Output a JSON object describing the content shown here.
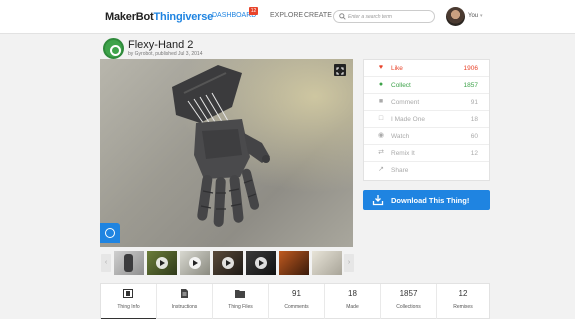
{
  "header": {
    "logo_makerbot": "MakerBot",
    "logo_thingiverse": "Thingiverse",
    "nav": [
      {
        "label": "DASHBOARD",
        "badge": "12"
      },
      {
        "label": "EXPLORE"
      },
      {
        "label": "CREATE"
      }
    ],
    "search_placeholder": "Enter a search term",
    "user_label": "You"
  },
  "thing": {
    "title": "Flexy-Hand 2",
    "byline": "by Gyrobot, published Jul 3, 2014"
  },
  "actions": [
    {
      "label": "Like",
      "count": "1906",
      "icon": "heart-icon",
      "color": "#e8432a"
    },
    {
      "label": "Collect",
      "count": "1857",
      "icon": "collect-icon",
      "color": "#3ea34a"
    },
    {
      "label": "Comment",
      "count": "91",
      "icon": "comment-icon",
      "color": "#aaaaaa"
    },
    {
      "label": "I Made One",
      "count": "18",
      "icon": "made-icon",
      "color": "#aaaaaa"
    },
    {
      "label": "Watch",
      "count": "60",
      "icon": "eye-icon",
      "color": "#aaaaaa"
    },
    {
      "label": "Remix It",
      "count": "12",
      "icon": "remix-icon",
      "color": "#aaaaaa"
    },
    {
      "label": "Share",
      "count": "",
      "icon": "share-icon",
      "color": "#aaaaaa"
    }
  ],
  "download_label": "Download This Thing!",
  "tabs": [
    {
      "label": "Thing Info",
      "value": "",
      "icon": "info-icon"
    },
    {
      "label": "Instructions",
      "value": "",
      "icon": "document-icon"
    },
    {
      "label": "Thing Files",
      "value": "",
      "icon": "folder-icon"
    },
    {
      "label": "Comments",
      "value": "91"
    },
    {
      "label": "Made",
      "value": "18"
    },
    {
      "label": "Collections",
      "value": "1857"
    },
    {
      "label": "Remixes",
      "value": "12"
    }
  ],
  "colors": {
    "accent": "#1f84e1",
    "like": "#e8432a",
    "collect": "#3ea34a"
  }
}
